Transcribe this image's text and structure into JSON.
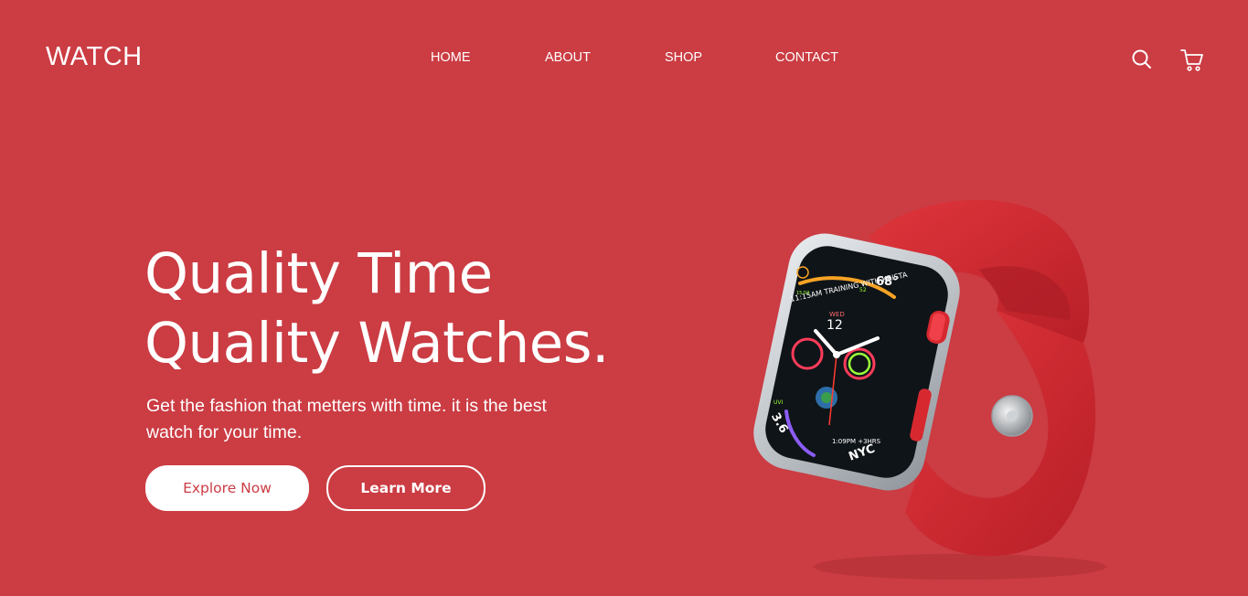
{
  "header": {
    "logo": "WATCH",
    "nav": [
      {
        "label": "HOME"
      },
      {
        "label": "ABOUT"
      },
      {
        "label": "SHOP"
      },
      {
        "label": "CONTACT"
      }
    ],
    "icons": [
      "search-icon",
      "cart-icon"
    ]
  },
  "hero": {
    "title_line1": "Quality Time",
    "title_line2": "Quality Watches.",
    "subtitle": "Get the fashion that metters with time. it is the best watch for your time.",
    "explore_label": "Explore Now",
    "learn_label": "Learn More"
  },
  "watch_face": {
    "day": "WED",
    "date": "12",
    "workout": "11:15AM TRAINING WITH KRISTA",
    "temp": "68°",
    "city": "NYC",
    "uv": "3.6",
    "uv_label": "UVI",
    "time_small": "1:09PM +3HRS",
    "stat_a": "52",
    "stat_b": "15:59"
  },
  "colors": {
    "background": "#cb3c43",
    "accent": "#ffffff",
    "band": "#d42b33"
  }
}
